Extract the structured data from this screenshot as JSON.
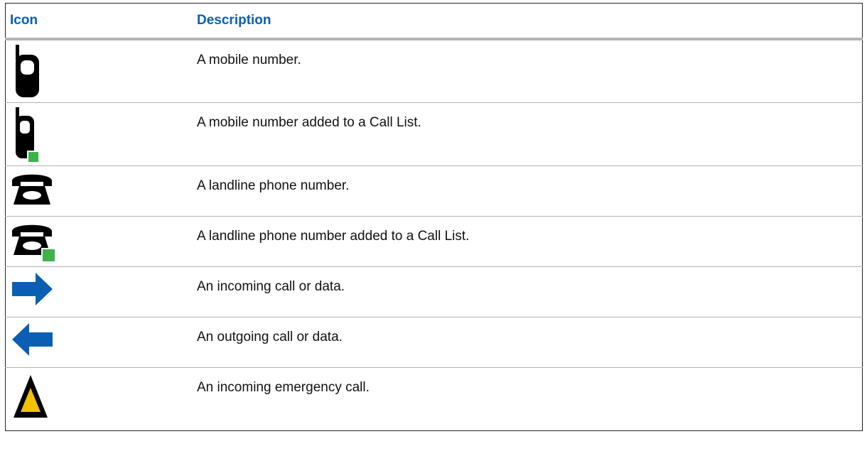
{
  "table": {
    "headers": {
      "icon": "Icon",
      "description": "Description"
    },
    "rows": [
      {
        "icon": "mobile-phone-icon",
        "description": "A mobile number."
      },
      {
        "icon": "mobile-phone-in-call-list-icon",
        "description": "A mobile number added to a Call List."
      },
      {
        "icon": "landline-phone-icon",
        "description": "A landline phone number."
      },
      {
        "icon": "landline-phone-in-call-list-icon",
        "description": "A landline phone number added to a Call List."
      },
      {
        "icon": "incoming-arrow-icon",
        "description": "An incoming call or data."
      },
      {
        "icon": "outgoing-arrow-icon",
        "description": "An outgoing call or data."
      },
      {
        "icon": "emergency-triangle-icon",
        "description": "An incoming emergency call."
      }
    ]
  },
  "colors": {
    "header_text": "#0a5fb4",
    "arrow_blue": "#0a5fb4",
    "call_list_green": "#3db34a",
    "emergency_yellow": "#f2c200"
  }
}
